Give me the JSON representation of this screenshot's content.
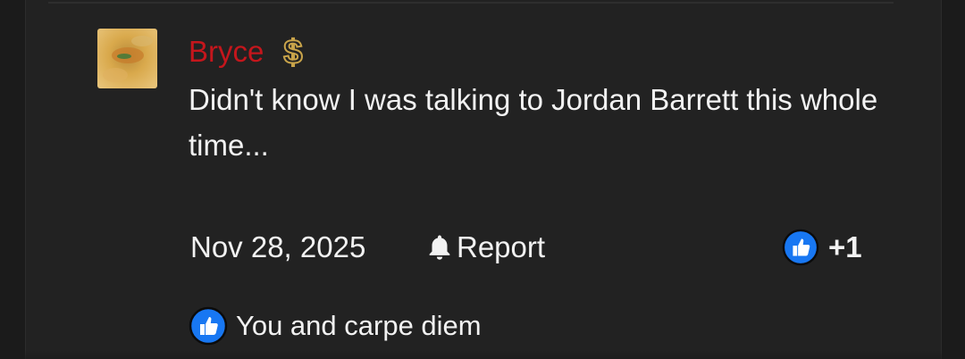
{
  "post": {
    "author": "Bryce",
    "badge_icon": "dollar-badge-icon",
    "message": "Didn't know I was talking to Jordan Barrett this whole time...",
    "date": "Nov 28, 2025",
    "report_label": "Report",
    "reaction_count": "+1",
    "reactors_text": "You and carpe diem"
  },
  "colors": {
    "author": "#c4161c",
    "text": "#f2f2f2",
    "card": "#222222",
    "like_blue": "#1877f2"
  }
}
